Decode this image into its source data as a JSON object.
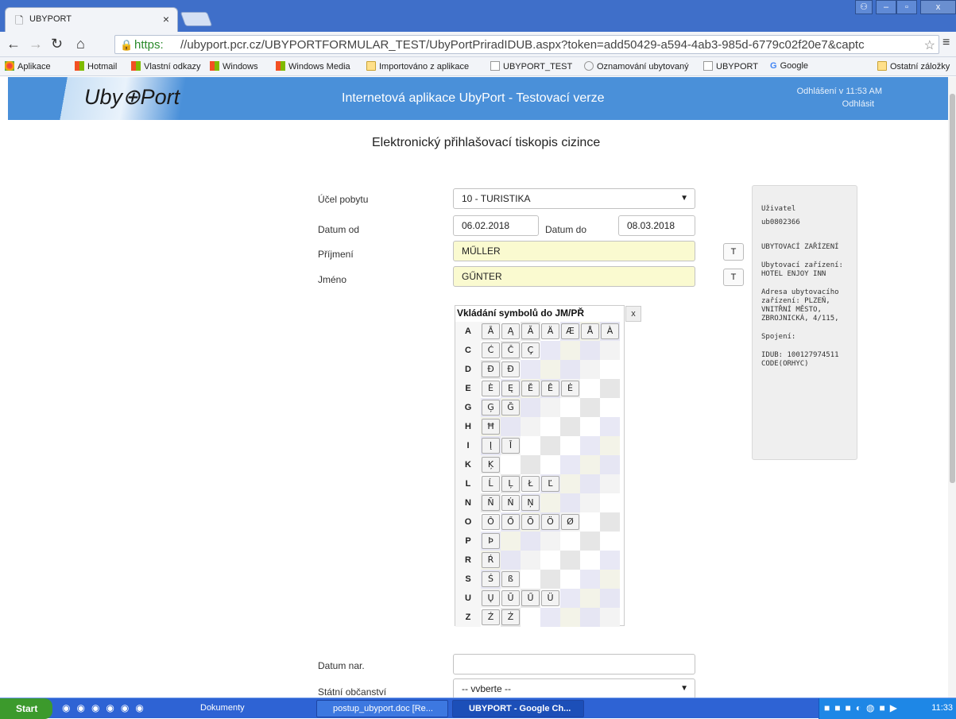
{
  "browser": {
    "tab_title": "UBYPORT",
    "tab_close": "×",
    "url_https": "https:",
    "url_rest": "//ubyport.pcr.cz/UBYPORTFORMULAR_TEST/UbyPortPriradIDUB.aspx?token=add50429-a594-4ab3-985d-6779c02f20e7&captc",
    "bookmarks": [
      "Aplikace",
      "Hotmail",
      "Vlastní odkazy",
      "Windows",
      "Windows Media",
      "Importováno z aplikace",
      "UBYPORT_TEST",
      "Oznamování ubytovaný",
      "UBYPORT",
      "Google",
      "Ostatní záložky"
    ]
  },
  "header": {
    "logo": "Uby⊕Port",
    "title": "Internetová aplikace UbyPort - Testovací verze",
    "logout_time": "Odhlášení v 11:53 AM",
    "logout_link": "Odhlásit"
  },
  "page_heading": "Elektronický přihlašovací tiskopis cizince",
  "form": {
    "ucel_label": "Účel pobytu",
    "ucel_value": "10 - TURISTIKA",
    "datum_od_label": "Datum od",
    "datum_od_value": "06.02.2018",
    "datum_do_label": "Datum do",
    "datum_do_value": "08.03.2018",
    "prijmeni_label": "Příjmení",
    "prijmeni_value": "MŰLLER",
    "jmeno_label": "Jméno",
    "jmeno_value": "GŰNTER",
    "t_button": "T",
    "datum_nar_label": "Datum nar.",
    "datum_nar_value": "",
    "obcanstvi_label": "Státní občanství",
    "obcanstvi_value": "-- vvberte --"
  },
  "symbols": {
    "title": "Vkládání symbolů do JM/PŘ",
    "close": "x",
    "rows": [
      {
        "letter": "A",
        "chars": [
          "Ā",
          "Ą",
          "Ă",
          "Ä",
          "Æ",
          "Å",
          "À"
        ]
      },
      {
        "letter": "C",
        "chars": [
          "Ć",
          "Č",
          "Ç"
        ]
      },
      {
        "letter": "D",
        "chars": [
          "Đ",
          "Ð"
        ]
      },
      {
        "letter": "E",
        "chars": [
          "È",
          "Ę",
          "Ě",
          "Ê",
          "Ė"
        ]
      },
      {
        "letter": "G",
        "chars": [
          "Ģ",
          "Ğ"
        ]
      },
      {
        "letter": "H",
        "chars": [
          "Ħ"
        ]
      },
      {
        "letter": "I",
        "chars": [
          "Į",
          "Ī"
        ]
      },
      {
        "letter": "K",
        "chars": [
          "Ķ"
        ]
      },
      {
        "letter": "L",
        "chars": [
          "Ĺ",
          "Ļ",
          "Ł",
          "Ľ"
        ]
      },
      {
        "letter": "N",
        "chars": [
          "Ñ",
          "Ń",
          "Ņ"
        ]
      },
      {
        "letter": "O",
        "chars": [
          "Ô",
          "Ő",
          "Õ",
          "Ö",
          "Ø"
        ]
      },
      {
        "letter": "P",
        "chars": [
          "Þ"
        ]
      },
      {
        "letter": "R",
        "chars": [
          "Ŕ"
        ]
      },
      {
        "letter": "S",
        "chars": [
          "Ś",
          "ß"
        ]
      },
      {
        "letter": "U",
        "chars": [
          "Ų",
          "Ū",
          "Ű",
          "Ü"
        ]
      },
      {
        "letter": "Z",
        "chars": [
          "Ź",
          "Ż"
        ]
      }
    ]
  },
  "user_info": {
    "user_label": "Uživatel",
    "user_value": "ub0802366",
    "zarizeni_heading": "UBYTOVACÍ ZAŘÍZENÍ",
    "zarizeni_line": "Ubytovací zařízení: HOTEL ENJOY INN",
    "adresa_line": "Adresa ubytovacího zařízení: PLZEŇ, VNITŘNÍ MĚSTO, ZBROJNICKÁ, 4/115,",
    "spojeni": "Spojení:",
    "idub": "IDUB: 100127974511 CODE(ORHYC)"
  },
  "taskbar": {
    "start": "Start",
    "items": [
      "Dokumenty",
      "postup_ubyport.doc [Re...",
      "UBYPORT - Google Ch..."
    ],
    "clock": "11:33"
  }
}
